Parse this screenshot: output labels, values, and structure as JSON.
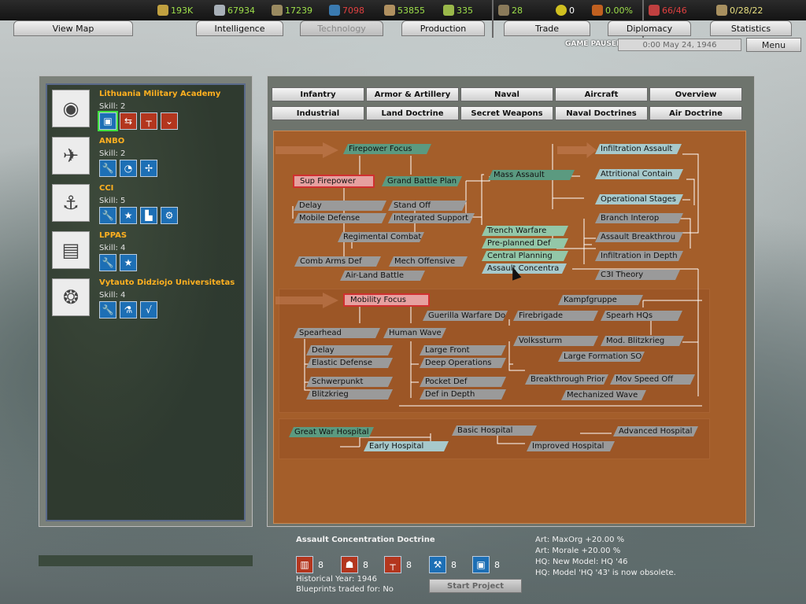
{
  "resources": [
    {
      "name": "energy",
      "icon": "energy-icon",
      "value": "193K",
      "color": "#c0a040"
    },
    {
      "name": "metal",
      "icon": "metal-icon",
      "value": "67934",
      "color": "#a8b0b8"
    },
    {
      "name": "rare_materials",
      "icon": "rare-materials-icon",
      "value": "17239",
      "color": "#9a8a60"
    },
    {
      "name": "oil",
      "icon": "oil-icon",
      "value": "7098",
      "color": "#3a7ab0"
    },
    {
      "name": "supplies",
      "icon": "supplies-icon",
      "value": "53855",
      "color": "#b09060"
    },
    {
      "name": "money",
      "icon": "money-icon",
      "value": "335",
      "color": "#9ab84a"
    },
    {
      "name": "manpower",
      "icon": "manpower-icon",
      "value": "28",
      "color": "#8a7a5a"
    },
    {
      "name": "nuclear",
      "icon": "nuclear-icon",
      "value": "0",
      "color": "#d0c020"
    },
    {
      "name": "dissent",
      "icon": "dissent-icon",
      "value": "0.00%",
      "color": "#c06020"
    },
    {
      "name": "transport",
      "icon": "transport-icon",
      "value": "66/46",
      "color": "#c04040"
    },
    {
      "name": "spies",
      "icon": "spies-icon",
      "value": "0/28/22",
      "color": "#a89060"
    }
  ],
  "nav_tabs": [
    "View Map",
    "Intelligence",
    "Technology",
    "Production",
    "Trade",
    "Diplomacy",
    "Statistics"
  ],
  "active_tab": "Technology",
  "status": {
    "paused": "GAME PAUSED",
    "date": "0:00 May 24, 1946",
    "menu": "Menu"
  },
  "teams": [
    {
      "name": "Lithuania Military Academy",
      "skill": "Skill: 2"
    },
    {
      "name": "ANBO",
      "skill": "Skill: 2"
    },
    {
      "name": "CCI",
      "skill": "Skill: 5"
    },
    {
      "name": "LPPAS",
      "skill": "Skill: 4"
    },
    {
      "name": "Vytauto Didziojo Universitetas",
      "skill": "Skill: 4"
    }
  ],
  "category_tabs_row1": [
    "Infantry",
    "Armor & Artillery",
    "Naval",
    "Aircraft",
    "Overview"
  ],
  "category_tabs_row2": [
    "Industrial",
    "Land Doctrine",
    "Secret Weapons",
    "Naval Doctrines",
    "Air Doctrine"
  ],
  "tree_nodes": {
    "firepower_focus": "Firepower Focus",
    "sup_firepower": "Sup Firepower",
    "grand_battle_plan": "Grand Battle Plan",
    "mass_assault": "Mass Assault",
    "infiltration_assault": "Infiltration Assault",
    "attritional_contain": "Attritional Contain",
    "operational_stages": "Operational Stages",
    "branch_interop": "Branch Interop",
    "assault_breakthrou": "Assault Breakthrou",
    "infiltration_in_depth": "Infiltration in Depth",
    "c3i_theory": "C3I Theory",
    "delay1": "Delay",
    "stand_off": "Stand Off",
    "mobile_defense": "Mobile Defense",
    "integrated_support": "Integrated Support",
    "regimental_combat": "Regimental Combat",
    "comb_arms_def": "Comb Arms Def",
    "mech_offensive": "Mech Offensive",
    "air_land_battle": "Air-Land Battle",
    "trench_warfare": "Trench Warfare",
    "pre_planned_def": "Pre-planned Def",
    "central_planning": "Central Planning",
    "assault_concentra": "Assault Concentra",
    "mobility_focus": "Mobility Focus",
    "guerilla_warfare": "Guerilla Warfare Do",
    "spearhead": "Spearhead",
    "human_wave": "Human Wave",
    "kampfgruppe": "Kampfgruppe",
    "firebrigade": "Firebrigade",
    "spearh_hqs": "Spearh HQs",
    "volkssturm": "Volkssturm",
    "mod_blitzkrieg": "Mod. Blitzkrieg",
    "delay2": "Delay",
    "elastic_defense": "Elastic Defense",
    "large_front": "Large Front",
    "deep_operations": "Deep Operations",
    "large_formation_so": "Large Formation SO",
    "schwerpunkt": "Schwerpunkt",
    "blitzkrieg": "Blitzkrieg",
    "pocket_def": "Pocket Def",
    "def_in_depth": "Def in Depth",
    "breakthrough_prior": "Breakthrough Prior",
    "mov_speed_off": "Mov Speed Off",
    "mechanized_wave": "Mechanized Wave",
    "great_war_hospital": "Great War Hospital",
    "basic_hospital": "Basic Hospital",
    "advanced_hospital": "Advanced Hospital",
    "early_hospital": "Early Hospital",
    "improved_hospital": "Improved Hospital"
  },
  "selected_tech": {
    "title": "Assault Concentration Doctrine",
    "costs": [
      "8",
      "8",
      "8",
      "8",
      "8"
    ],
    "historical_year": "Historical Year: 1946",
    "blueprints": "Blueprints traded for: No",
    "effects": [
      "Art: MaxOrg +20.00 %",
      "Art: Morale +20.00 %",
      "HQ: New Model: HQ '46",
      "HQ: Model 'HQ '43' is now obsolete."
    ],
    "start_button": "Start Project"
  }
}
